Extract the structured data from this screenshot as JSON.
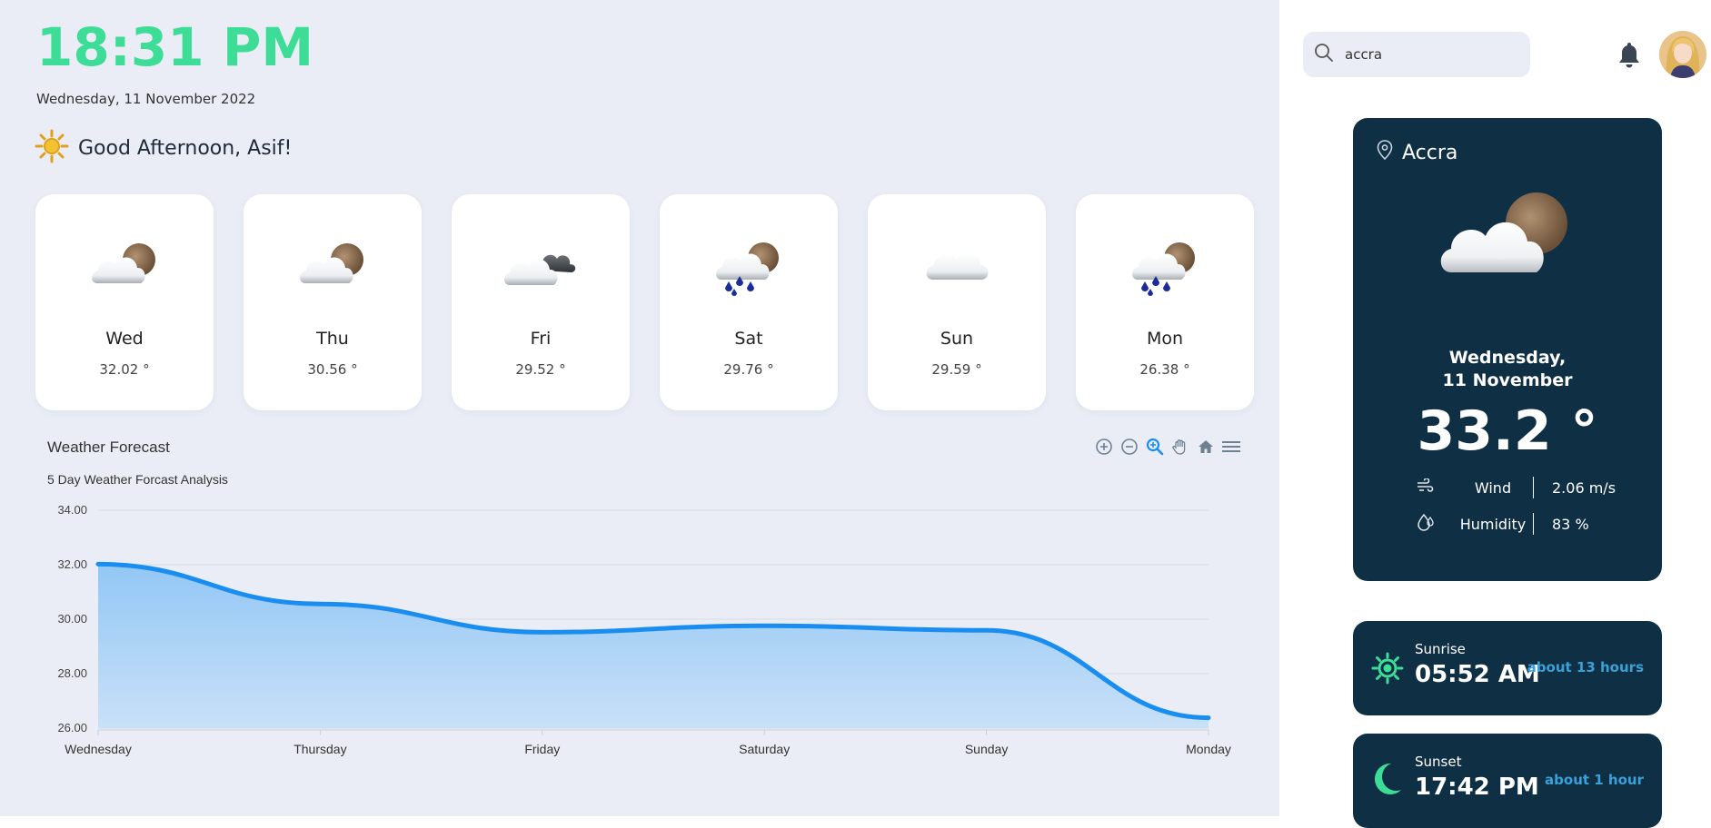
{
  "header": {
    "time": "18:31 PM",
    "date": "Wednesday, 11 November 2022",
    "greeting": "Good Afternoon, Asif!"
  },
  "forecast_cards": [
    {
      "day": "Wed",
      "temp": "32.02 °",
      "icon": "cloud-sun-icon"
    },
    {
      "day": "Thu",
      "temp": "30.56 °",
      "icon": "cloud-sun-icon"
    },
    {
      "day": "Fri",
      "temp": "29.52 °",
      "icon": "cloud-dark-cloud-icon"
    },
    {
      "day": "Sat",
      "temp": "29.76 °",
      "icon": "rain-sun-icon"
    },
    {
      "day": "Sun",
      "temp": "29.59 °",
      "icon": "cloud-icon"
    },
    {
      "day": "Mon",
      "temp": "26.38 °",
      "icon": "rain-sun-icon"
    }
  ],
  "chart": {
    "title": "Weather Forecast",
    "subtitle": "5 Day Weather Forcast Analysis",
    "toolbar": [
      "zoom-in-icon",
      "zoom-out-icon",
      "zoom-selection-icon",
      "pan-icon",
      "reset-home-icon",
      "menu-icon"
    ]
  },
  "chart_data": {
    "type": "area",
    "categories": [
      "Wednesday",
      "Thursday",
      "Friday",
      "Saturday",
      "Sunday",
      "Monday"
    ],
    "values": [
      32.02,
      30.56,
      29.52,
      29.76,
      29.59,
      26.38
    ],
    "ylim": [
      26,
      34
    ],
    "yticks": [
      "34.00",
      "32.00",
      "30.00",
      "28.00",
      "26.00"
    ],
    "grid": true,
    "color": "#1a8ef0"
  },
  "sidebar": {
    "search_value": "accra",
    "location": "Accra",
    "current_date": "Wednesday, 11 November",
    "current_temp": "33.2 °",
    "wind_label": "Wind",
    "wind_value": "2.06 m/s",
    "humidity_label": "Humidity",
    "humidity_value": "83 %",
    "sunrise_label": "Sunrise",
    "sunrise_time": "05:52 AM",
    "sunrise_rel": "about 13 hours",
    "sunset_label": "Sunset",
    "sunset_time": "17:42 PM",
    "sunset_rel": "about 1 hour"
  },
  "colors": {
    "accent": "#3ddc97",
    "card_dark": "#0f2f44",
    "link": "#3aa0d8",
    "bg_main": "#eaedf5"
  }
}
